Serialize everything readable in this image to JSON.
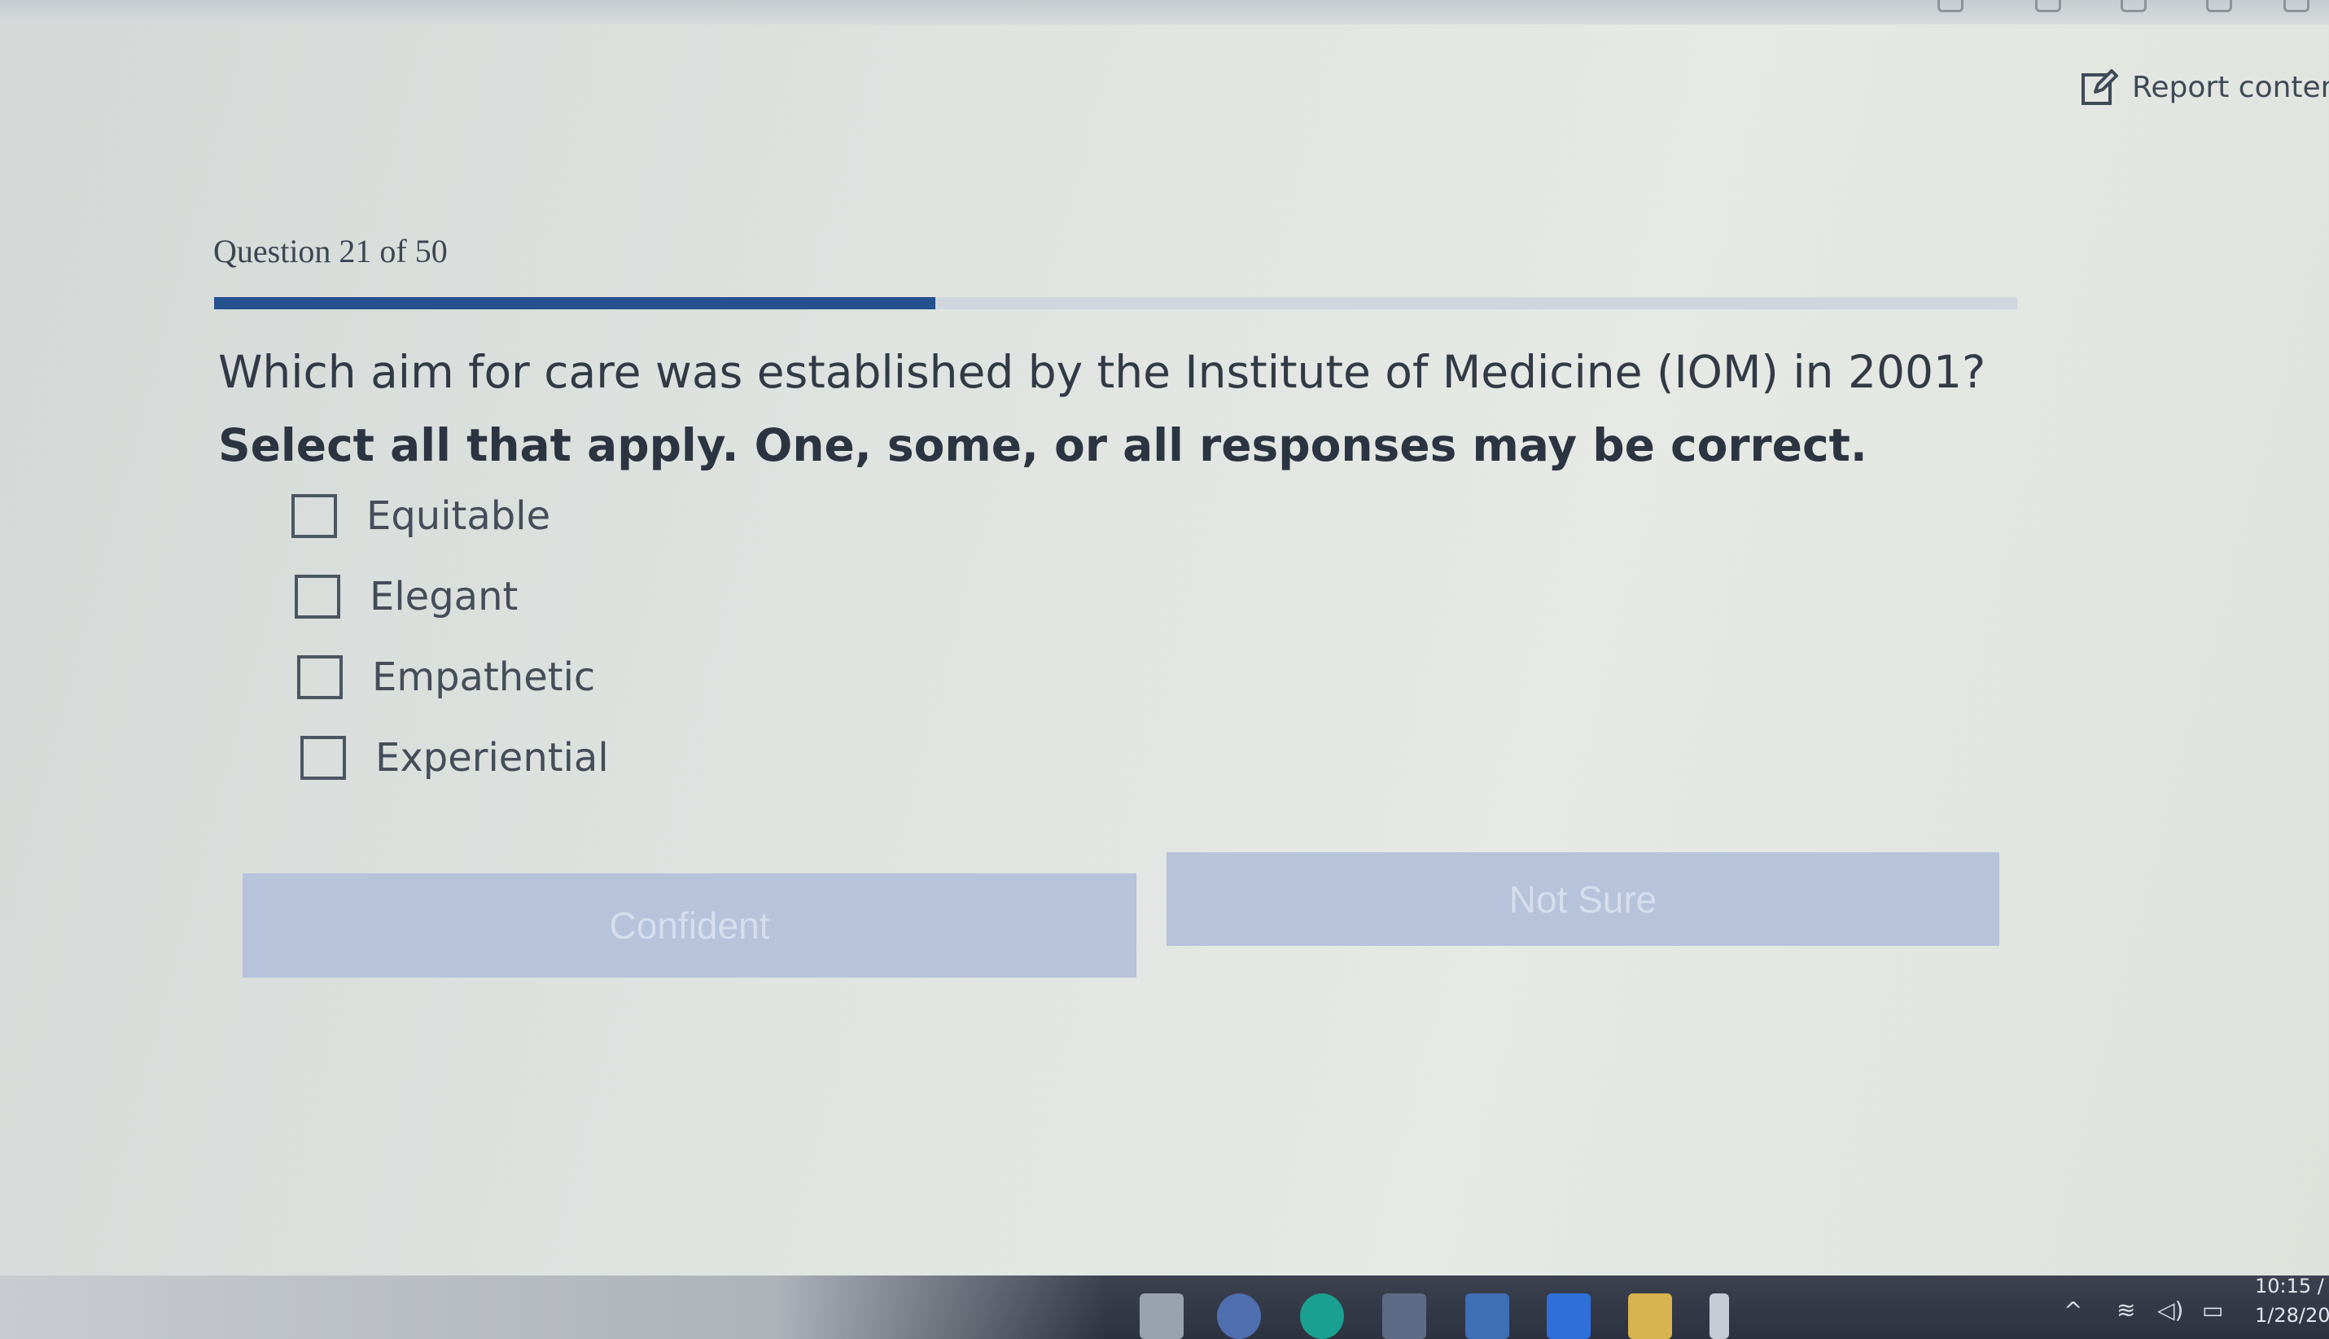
{
  "header": {
    "report_label": "Report content e",
    "report_icon": "edit-icon"
  },
  "quiz": {
    "counter": "Question 21 of 50",
    "progress_fraction": 0.4,
    "progress_color": "#26508e",
    "question_text": "Which aim for care was established by the Institute of Medicine (IOM) in 2001? ",
    "question_instruction": "Select all that apply. One, some, or all responses may be correct.",
    "options": [
      {
        "label": "Equitable",
        "checked": false
      },
      {
        "label": "Elegant",
        "checked": false
      },
      {
        "label": "Empathetic",
        "checked": false
      },
      {
        "label": "Experiential",
        "checked": false
      }
    ],
    "confident_label": "Confident",
    "not_sure_label": "Not Sure"
  },
  "taskbar": {
    "time": "10:15 /",
    "date": "1/28/20",
    "icons": [
      "app-icon",
      "edge-icon",
      "store-icon",
      "mail-icon",
      "dropbox-icon",
      "folder-icon",
      "app-icon"
    ],
    "tray_icons": [
      "chevron-up-icon",
      "wifi-icon",
      "volume-icon",
      "battery-icon"
    ]
  }
}
